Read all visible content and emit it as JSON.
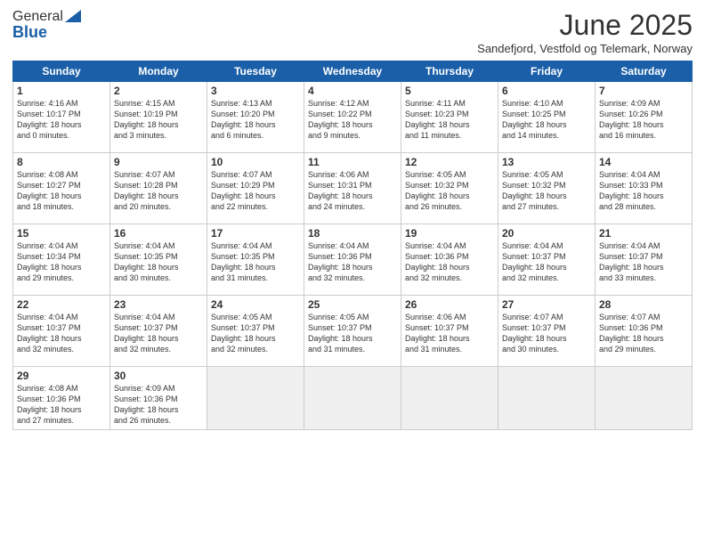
{
  "header": {
    "logo_general": "General",
    "logo_blue": "Blue",
    "month_title": "June 2025",
    "subtitle": "Sandefjord, Vestfold og Telemark, Norway"
  },
  "days_of_week": [
    "Sunday",
    "Monday",
    "Tuesday",
    "Wednesday",
    "Thursday",
    "Friday",
    "Saturday"
  ],
  "weeks": [
    [
      {
        "day": "1",
        "info": "Sunrise: 4:16 AM\nSunset: 10:17 PM\nDaylight: 18 hours\nand 0 minutes."
      },
      {
        "day": "2",
        "info": "Sunrise: 4:15 AM\nSunset: 10:19 PM\nDaylight: 18 hours\nand 3 minutes."
      },
      {
        "day": "3",
        "info": "Sunrise: 4:13 AM\nSunset: 10:20 PM\nDaylight: 18 hours\nand 6 minutes."
      },
      {
        "day": "4",
        "info": "Sunrise: 4:12 AM\nSunset: 10:22 PM\nDaylight: 18 hours\nand 9 minutes."
      },
      {
        "day": "5",
        "info": "Sunrise: 4:11 AM\nSunset: 10:23 PM\nDaylight: 18 hours\nand 11 minutes."
      },
      {
        "day": "6",
        "info": "Sunrise: 4:10 AM\nSunset: 10:25 PM\nDaylight: 18 hours\nand 14 minutes."
      },
      {
        "day": "7",
        "info": "Sunrise: 4:09 AM\nSunset: 10:26 PM\nDaylight: 18 hours\nand 16 minutes."
      }
    ],
    [
      {
        "day": "8",
        "info": "Sunrise: 4:08 AM\nSunset: 10:27 PM\nDaylight: 18 hours\nand 18 minutes."
      },
      {
        "day": "9",
        "info": "Sunrise: 4:07 AM\nSunset: 10:28 PM\nDaylight: 18 hours\nand 20 minutes."
      },
      {
        "day": "10",
        "info": "Sunrise: 4:07 AM\nSunset: 10:29 PM\nDaylight: 18 hours\nand 22 minutes."
      },
      {
        "day": "11",
        "info": "Sunrise: 4:06 AM\nSunset: 10:31 PM\nDaylight: 18 hours\nand 24 minutes."
      },
      {
        "day": "12",
        "info": "Sunrise: 4:05 AM\nSunset: 10:32 PM\nDaylight: 18 hours\nand 26 minutes."
      },
      {
        "day": "13",
        "info": "Sunrise: 4:05 AM\nSunset: 10:32 PM\nDaylight: 18 hours\nand 27 minutes."
      },
      {
        "day": "14",
        "info": "Sunrise: 4:04 AM\nSunset: 10:33 PM\nDaylight: 18 hours\nand 28 minutes."
      }
    ],
    [
      {
        "day": "15",
        "info": "Sunrise: 4:04 AM\nSunset: 10:34 PM\nDaylight: 18 hours\nand 29 minutes."
      },
      {
        "day": "16",
        "info": "Sunrise: 4:04 AM\nSunset: 10:35 PM\nDaylight: 18 hours\nand 30 minutes."
      },
      {
        "day": "17",
        "info": "Sunrise: 4:04 AM\nSunset: 10:35 PM\nDaylight: 18 hours\nand 31 minutes."
      },
      {
        "day": "18",
        "info": "Sunrise: 4:04 AM\nSunset: 10:36 PM\nDaylight: 18 hours\nand 32 minutes."
      },
      {
        "day": "19",
        "info": "Sunrise: 4:04 AM\nSunset: 10:36 PM\nDaylight: 18 hours\nand 32 minutes."
      },
      {
        "day": "20",
        "info": "Sunrise: 4:04 AM\nSunset: 10:37 PM\nDaylight: 18 hours\nand 32 minutes."
      },
      {
        "day": "21",
        "info": "Sunrise: 4:04 AM\nSunset: 10:37 PM\nDaylight: 18 hours\nand 33 minutes."
      }
    ],
    [
      {
        "day": "22",
        "info": "Sunrise: 4:04 AM\nSunset: 10:37 PM\nDaylight: 18 hours\nand 32 minutes."
      },
      {
        "day": "23",
        "info": "Sunrise: 4:04 AM\nSunset: 10:37 PM\nDaylight: 18 hours\nand 32 minutes."
      },
      {
        "day": "24",
        "info": "Sunrise: 4:05 AM\nSunset: 10:37 PM\nDaylight: 18 hours\nand 32 minutes."
      },
      {
        "day": "25",
        "info": "Sunrise: 4:05 AM\nSunset: 10:37 PM\nDaylight: 18 hours\nand 31 minutes."
      },
      {
        "day": "26",
        "info": "Sunrise: 4:06 AM\nSunset: 10:37 PM\nDaylight: 18 hours\nand 31 minutes."
      },
      {
        "day": "27",
        "info": "Sunrise: 4:07 AM\nSunset: 10:37 PM\nDaylight: 18 hours\nand 30 minutes."
      },
      {
        "day": "28",
        "info": "Sunrise: 4:07 AM\nSunset: 10:36 PM\nDaylight: 18 hours\nand 29 minutes."
      }
    ],
    [
      {
        "day": "29",
        "info": "Sunrise: 4:08 AM\nSunset: 10:36 PM\nDaylight: 18 hours\nand 27 minutes."
      },
      {
        "day": "30",
        "info": "Sunrise: 4:09 AM\nSunset: 10:36 PM\nDaylight: 18 hours\nand 26 minutes."
      },
      {
        "day": "",
        "info": ""
      },
      {
        "day": "",
        "info": ""
      },
      {
        "day": "",
        "info": ""
      },
      {
        "day": "",
        "info": ""
      },
      {
        "day": "",
        "info": ""
      }
    ]
  ]
}
